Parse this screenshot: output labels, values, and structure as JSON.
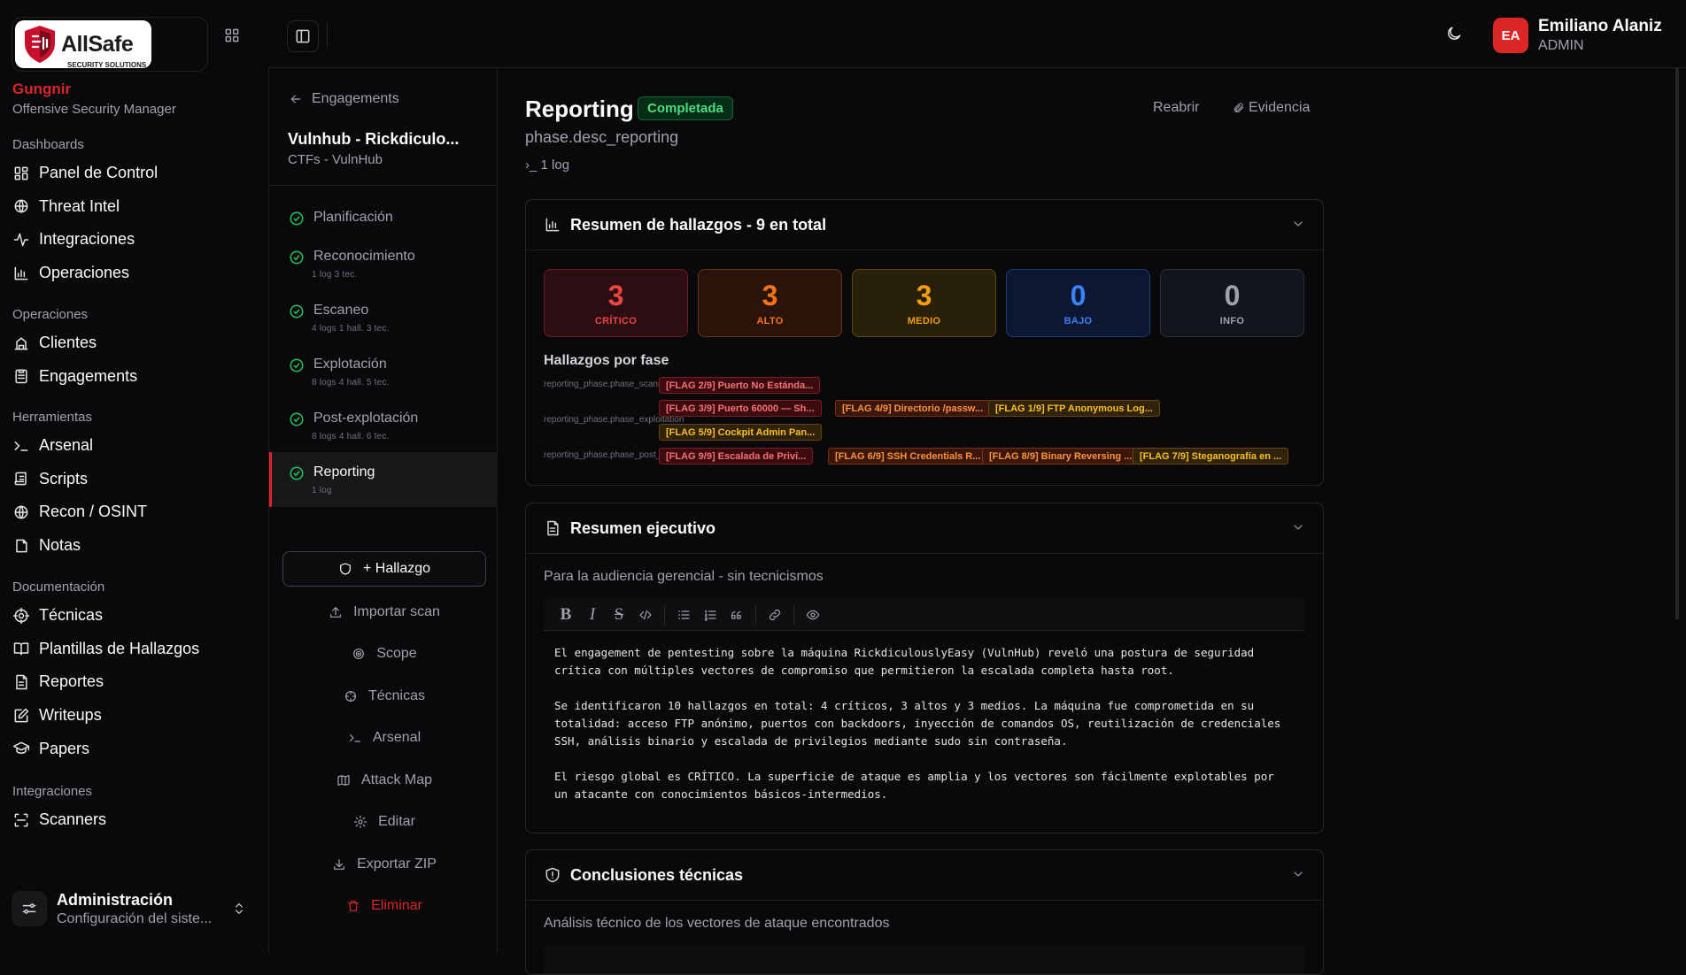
{
  "brand": {
    "name": "AllSafe",
    "tagline": "SECURITY SOLUTIONS"
  },
  "org": {
    "name": "Gungnir",
    "role": "Offensive Security Manager"
  },
  "nav": [
    {
      "heading": "Dashboards",
      "items": [
        {
          "label": "Panel de Control",
          "icon": "dashboard-icon"
        },
        {
          "label": "Threat Intel",
          "icon": "globe-icon"
        },
        {
          "label": "Integraciones",
          "icon": "activity-icon"
        },
        {
          "label": "Operaciones",
          "icon": "chart-icon"
        }
      ]
    },
    {
      "heading": "Operaciones",
      "items": [
        {
          "label": "Clientes",
          "icon": "building-icon"
        },
        {
          "label": "Engagements",
          "icon": "clipboard-icon"
        }
      ]
    },
    {
      "heading": "Herramientas",
      "items": [
        {
          "label": "Arsenal",
          "icon": "terminal-icon"
        },
        {
          "label": "Scripts",
          "icon": "scroll-icon"
        },
        {
          "label": "Recon / OSINT",
          "icon": "globe-icon"
        },
        {
          "label": "Notas",
          "icon": "note-icon"
        }
      ]
    },
    {
      "heading": "Documentación",
      "items": [
        {
          "label": "Técnicas",
          "icon": "target-icon"
        },
        {
          "label": "Plantillas de Hallazgos",
          "icon": "book-icon"
        },
        {
          "label": "Reportes",
          "icon": "file-icon"
        },
        {
          "label": "Writeups",
          "icon": "edit-icon"
        },
        {
          "label": "Papers",
          "icon": "graduation-icon"
        }
      ]
    },
    {
      "heading": "Integraciones",
      "items": [
        {
          "label": "Scanners",
          "icon": "scan-icon"
        }
      ]
    }
  ],
  "admin": {
    "title": "Administración",
    "subtitle": "Configuración del siste..."
  },
  "user": {
    "initials": "EA",
    "name": "Emiliano Alaniz",
    "role": "ADMIN"
  },
  "engagement": {
    "back_label": "Engagements",
    "title": "Vulnhub - Rickdiculo...",
    "subtitle": "CTFs - VulnHub"
  },
  "phases": [
    {
      "name": "Planificación",
      "meta": ""
    },
    {
      "name": "Reconocimiento",
      "meta": "1 log   3 tec."
    },
    {
      "name": "Escaneo",
      "meta": "4 logs   1 hall.   3 tec."
    },
    {
      "name": "Explotación",
      "meta": "8 logs   4 hall.   5 tec."
    },
    {
      "name": "Post-explotación",
      "meta": "8 logs   4 hall.   6 tec."
    },
    {
      "name": "Reporting",
      "meta": "1 log",
      "active": true
    }
  ],
  "actions": {
    "add_finding": "+ Hallazgo",
    "import_scan": "Importar scan",
    "scope": "Scope",
    "techniques": "Técnicas",
    "arsenal": "Arsenal",
    "attack_map": "Attack Map",
    "edit": "Editar",
    "export_zip": "Exportar ZIP",
    "delete": "Eliminar"
  },
  "phase_header": {
    "title": "Reporting",
    "status": "Completada",
    "desc": "phase.desc_reporting",
    "log": "1 log",
    "reopen": "Reabrir",
    "evidence": "Evidencia"
  },
  "summary": {
    "title": "Resumen de hallazgos - 9 en total",
    "severities": [
      {
        "count": "3",
        "label": "CRÍTICO"
      },
      {
        "count": "3",
        "label": "ALTO"
      },
      {
        "count": "3",
        "label": "MEDIO"
      },
      {
        "count": "0",
        "label": "BAJO"
      },
      {
        "count": "0",
        "label": "INFO"
      }
    ],
    "by_phase_title": "Hallazgos por fase",
    "rows": [
      {
        "label": "reporting_phase.phase_scanning",
        "tags": [
          {
            "text": "[FLAG 2/9] Puerto No Estánda...",
            "sev": "critical"
          }
        ]
      },
      {
        "label": "reporting_phase.phase_exploitation",
        "tags": [
          {
            "text": "[FLAG 3/9] Puerto 60000 — Sh...",
            "sev": "critical"
          },
          {
            "text": "[FLAG 4/9] Directorio /passw...",
            "sev": "high"
          },
          {
            "text": "[FLAG 1/9] FTP Anonymous Log...",
            "sev": "medium"
          },
          {
            "text": "[FLAG 5/9] Cockpit Admin Pan...",
            "sev": "medium"
          }
        ]
      },
      {
        "label": "reporting_phase.phase_post_exploitation",
        "tags": [
          {
            "text": "[FLAG 9/9] Escalada de Privi...",
            "sev": "critical"
          },
          {
            "text": "[FLAG 6/9] SSH Credentials R...",
            "sev": "high"
          },
          {
            "text": "[FLAG 8/9] Binary Reversing ...",
            "sev": "high"
          },
          {
            "text": "[FLAG 7/9] Steganografía en ...",
            "sev": "medium"
          }
        ]
      }
    ]
  },
  "executive": {
    "title": "Resumen ejecutivo",
    "subtitle": "Para la audiencia gerencial - sin tecnicismos",
    "paragraphs": [
      "El engagement de pentesting sobre la máquina RickdiculouslyEasy (VulnHub) reveló una postura de seguridad crítica con múltiples vectores de compromiso que permitieron la escalada completa hasta root.",
      "Se identificaron 10 hallazgos en total: 4 críticos, 3 altos y 3 medios. La máquina fue comprometida en su totalidad: acceso FTP anónimo, puertos con backdoors, inyección de comandos OS, reutilización de credenciales SSH, análisis binario y escalada de privilegios mediante sudo sin contraseña.",
      "El riesgo global es CRÍTICO. La superficie de ataque es amplia y los vectores son fácilmente explotables por un atacante con conocimientos básicos-intermedios."
    ]
  },
  "technical": {
    "title": "Conclusiones técnicas",
    "subtitle": "Análisis técnico de los vectores de ataque encontrados"
  },
  "colors": {
    "accent": "#dc2626",
    "success": "#22c55e",
    "critical": "#ef4444",
    "high": "#f97316",
    "medium": "#f59e0b",
    "low": "#3b82f6"
  }
}
